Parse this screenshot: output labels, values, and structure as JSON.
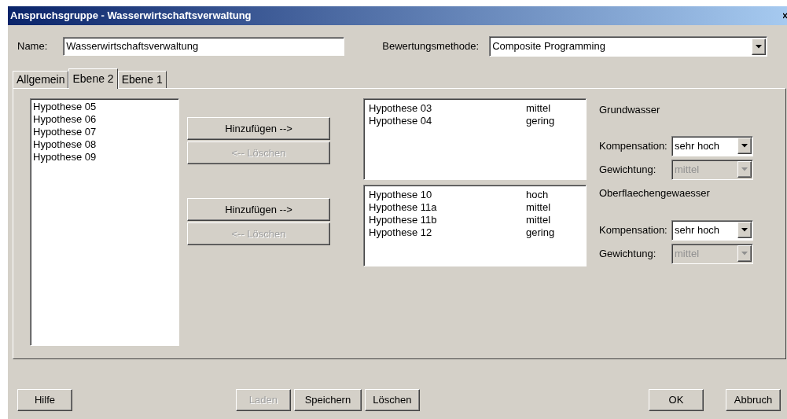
{
  "window": {
    "title": "Anspruchsgruppe - Wasserwirtschaftsverwaltung"
  },
  "name_field": {
    "label": "Name:",
    "value": "Wasserwirtschaftsverwaltung"
  },
  "method_field": {
    "label": "Bewertungsmethode:",
    "value": "Composite Programming",
    "disabled": false
  },
  "tabs": [
    {
      "label": "Allgemein",
      "selected": false
    },
    {
      "label": "Ebene 2",
      "selected": true
    },
    {
      "label": "Ebene 1",
      "selected": false
    }
  ],
  "available_list": {
    "items": [
      "Hypothese 05",
      "Hypothese 06",
      "Hypothese 07",
      "Hypothese 08",
      "Hypothese 09"
    ]
  },
  "groups": [
    {
      "add_button": {
        "label": "Hinzufügen -->",
        "disabled": false
      },
      "remove_button": {
        "label": "<-- Löschen",
        "disabled": true
      },
      "rows": [
        {
          "name": "Hypothese 03",
          "level": "mittel"
        },
        {
          "name": "Hypothese 04",
          "level": "gering"
        }
      ],
      "title": "Grundwasser",
      "compensation": {
        "label": "Kompensation:",
        "value": "sehr hoch",
        "disabled": false
      },
      "weighting": {
        "label": "Gewichtung:",
        "value": "mittel",
        "disabled": true
      }
    },
    {
      "add_button": {
        "label": "Hinzufügen -->",
        "disabled": false
      },
      "remove_button": {
        "label": "<-- Löschen",
        "disabled": true
      },
      "rows": [
        {
          "name": "Hypothese 10",
          "level": "hoch"
        },
        {
          "name": "Hypothese 11a",
          "level": "mittel"
        },
        {
          "name": "Hypothese 11b",
          "level": "mittel"
        },
        {
          "name": "Hypothese 12",
          "level": "gering"
        }
      ],
      "title": "Oberflaechengewaesser",
      "compensation": {
        "label": "Kompensation:",
        "value": "sehr hoch",
        "disabled": false
      },
      "weighting": {
        "label": "Gewichtung:",
        "value": "mittel",
        "disabled": true
      }
    }
  ],
  "footer": {
    "left": [
      {
        "label": "Hilfe",
        "disabled": false
      }
    ],
    "center": [
      {
        "label": "Laden",
        "disabled": true
      },
      {
        "label": "Speichern",
        "disabled": false
      },
      {
        "label": "Löschen",
        "disabled": false
      }
    ],
    "right": [
      {
        "label": "OK",
        "disabled": false
      },
      {
        "label": "Abbruch",
        "disabled": false
      }
    ]
  }
}
